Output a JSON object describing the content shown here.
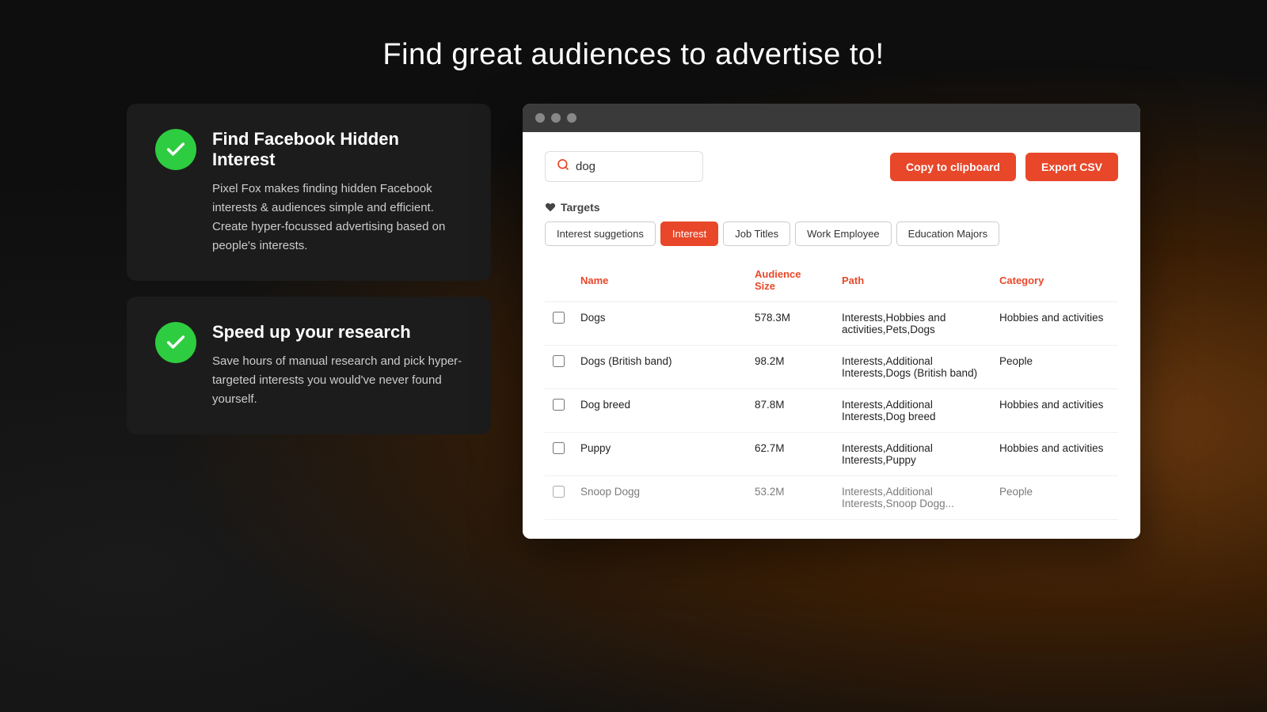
{
  "page": {
    "title": "Find great audiences to advertise to!"
  },
  "features": [
    {
      "id": "feature-1",
      "title": "Find Facebook Hidden Interest",
      "description": "Pixel Fox makes finding hidden Facebook interests & audiences simple and efficient. Create hyper-focussed advertising based on people's interests."
    },
    {
      "id": "feature-2",
      "title": "Speed up your research",
      "description": "Save hours of manual research and pick hyper-targeted interests you would've never found yourself."
    }
  ],
  "browser": {
    "search": {
      "value": "dog",
      "placeholder": "Search interests..."
    },
    "buttons": {
      "copy": "Copy to clipboard",
      "export": "Export CSV"
    },
    "targets": {
      "label": "Targets",
      "tabs": [
        {
          "id": "interest-suggestions",
          "label": "Interest suggetions",
          "active": false
        },
        {
          "id": "interest",
          "label": "Interest",
          "active": true
        },
        {
          "id": "job-titles",
          "label": "Job Titles",
          "active": false
        },
        {
          "id": "work-employee",
          "label": "Work Employee",
          "active": false
        },
        {
          "id": "education-majors",
          "label": "Education Majors",
          "active": false
        }
      ]
    },
    "table": {
      "columns": [
        {
          "id": "name",
          "label": "Name"
        },
        {
          "id": "audience-size",
          "label": "Audience Size"
        },
        {
          "id": "path",
          "label": "Path"
        },
        {
          "id": "category",
          "label": "Category"
        }
      ],
      "rows": [
        {
          "name": "Dogs",
          "audienceSize": "578.3M",
          "path": "Interests,Hobbies and activities,Pets,Dogs",
          "category": "Hobbies and activities"
        },
        {
          "name": "Dogs (British band)",
          "audienceSize": "98.2M",
          "path": "Interests,Additional Interests,Dogs (British band)",
          "category": "People"
        },
        {
          "name": "Dog breed",
          "audienceSize": "87.8M",
          "path": "Interests,Additional Interests,Dog breed",
          "category": "Hobbies and activities"
        },
        {
          "name": "Puppy",
          "audienceSize": "62.7M",
          "path": "Interests,Additional Interests,Puppy",
          "category": "Hobbies and activities"
        },
        {
          "name": "Snoop Dogg",
          "audienceSize": "53.2M",
          "path": "Interests,Additional Interests,Snoop Dogg...",
          "category": "People"
        }
      ]
    }
  }
}
